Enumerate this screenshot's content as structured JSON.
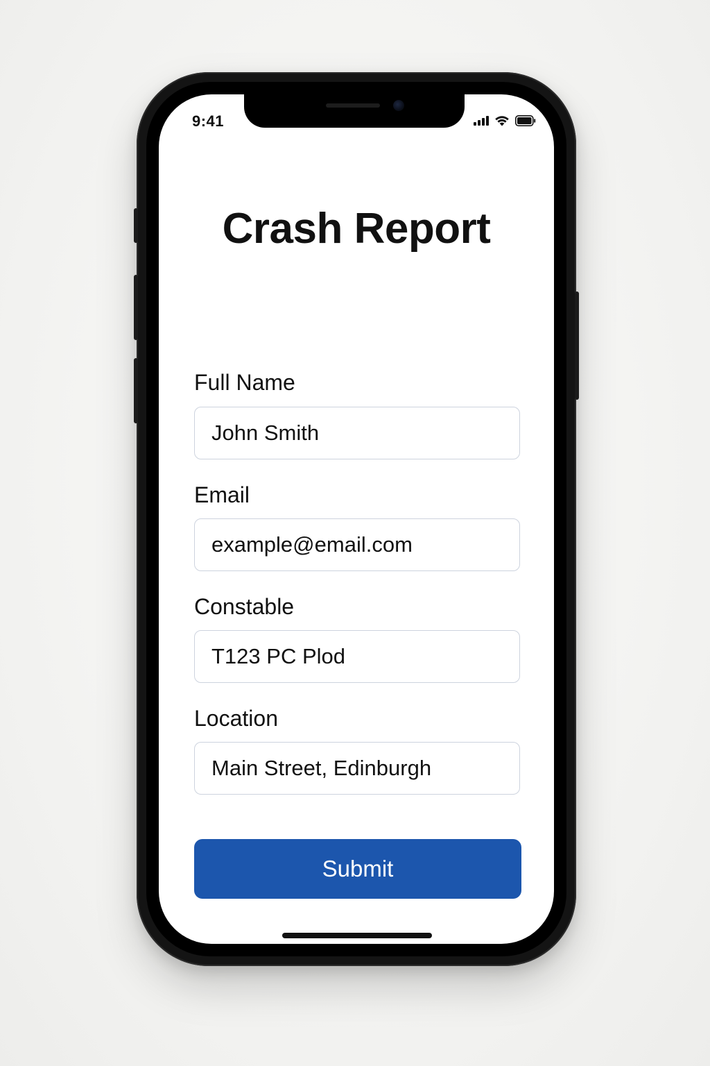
{
  "status_bar": {
    "time": "9:41",
    "icons": [
      "signal-icon",
      "wifi-icon",
      "battery-icon"
    ]
  },
  "form": {
    "title": "Crash Report",
    "fields": [
      {
        "label": "Full Name",
        "value": "John Smith"
      },
      {
        "label": "Email",
        "value": "example@email.com"
      },
      {
        "label": "Constable",
        "value": "T123 PC Plod"
      },
      {
        "label": "Location",
        "value": "Main Street, Edinburgh"
      }
    ],
    "submit_label": "Submit"
  },
  "colors": {
    "accent": "#1c56ad",
    "text": "#111111",
    "input_border": "#cdd3de",
    "screen_background": "#ffffff",
    "phone_frame": "#141414"
  }
}
